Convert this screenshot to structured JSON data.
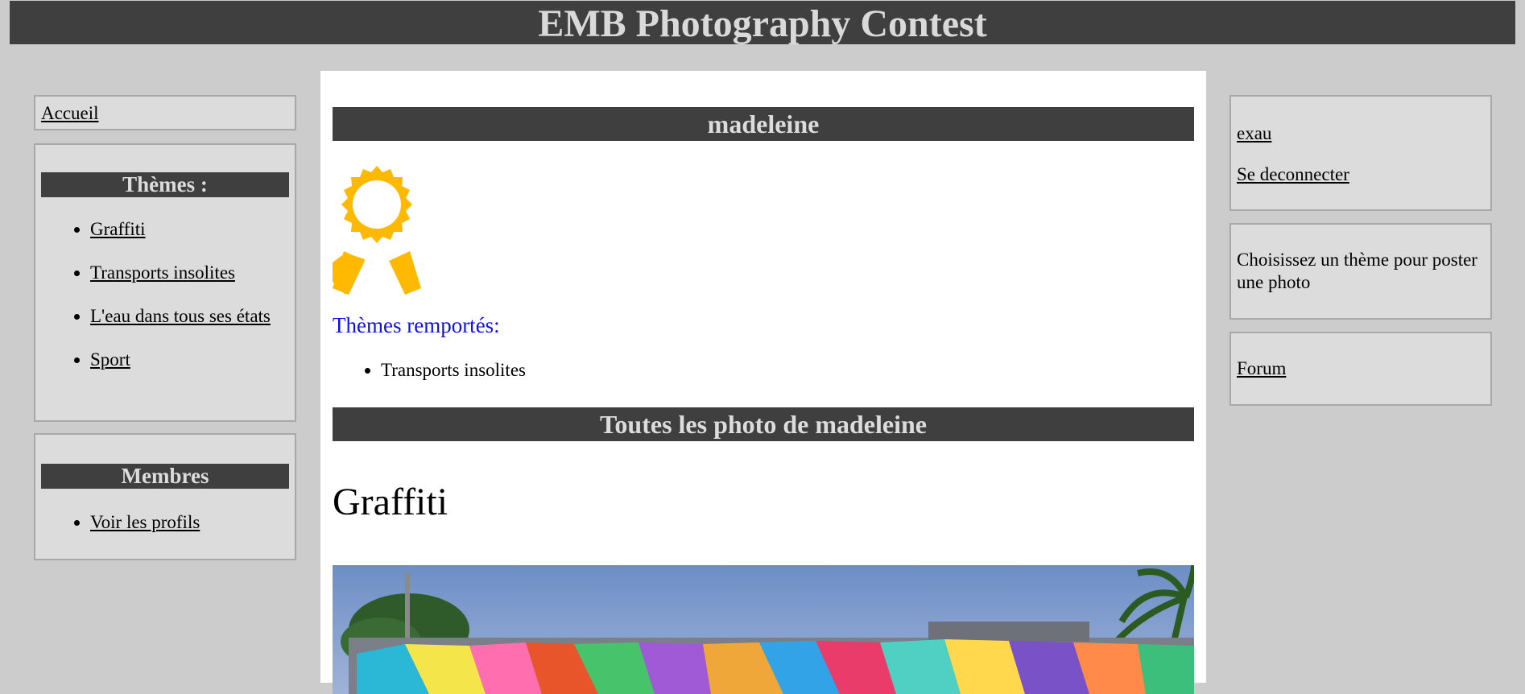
{
  "header": {
    "title": "EMB Photography Contest"
  },
  "left_sidebar": {
    "home_link": "Accueil",
    "themes": {
      "title": "Thèmes :",
      "items": [
        "Graffiti",
        "Transports insolites",
        "L'eau dans tous ses états",
        "Sport"
      ]
    },
    "members": {
      "title": "Membres",
      "items": [
        "Voir les profils"
      ]
    }
  },
  "main": {
    "profile_name": "madeleine",
    "won_themes_title": "Thèmes remportés:",
    "won_themes": [
      "Transports insolites"
    ],
    "all_photos_title": "Toutes les photo de madeleine",
    "photo_theme_heading": "Graffiti"
  },
  "right_sidebar": {
    "username_link": "exau",
    "logout_link": "Se deconnecter",
    "info_text": "Choisissez un thème pour poster une photo",
    "forum_link": "Forum"
  },
  "colors": {
    "header_bg": "#3f3f3f",
    "header_text": "#d9d9d9",
    "page_bg": "#cccccc",
    "box_bg": "#dcdcdc",
    "medal": "#ffb900",
    "won_title": "#1010ee"
  },
  "icons": {
    "award": "award-medal-icon"
  }
}
